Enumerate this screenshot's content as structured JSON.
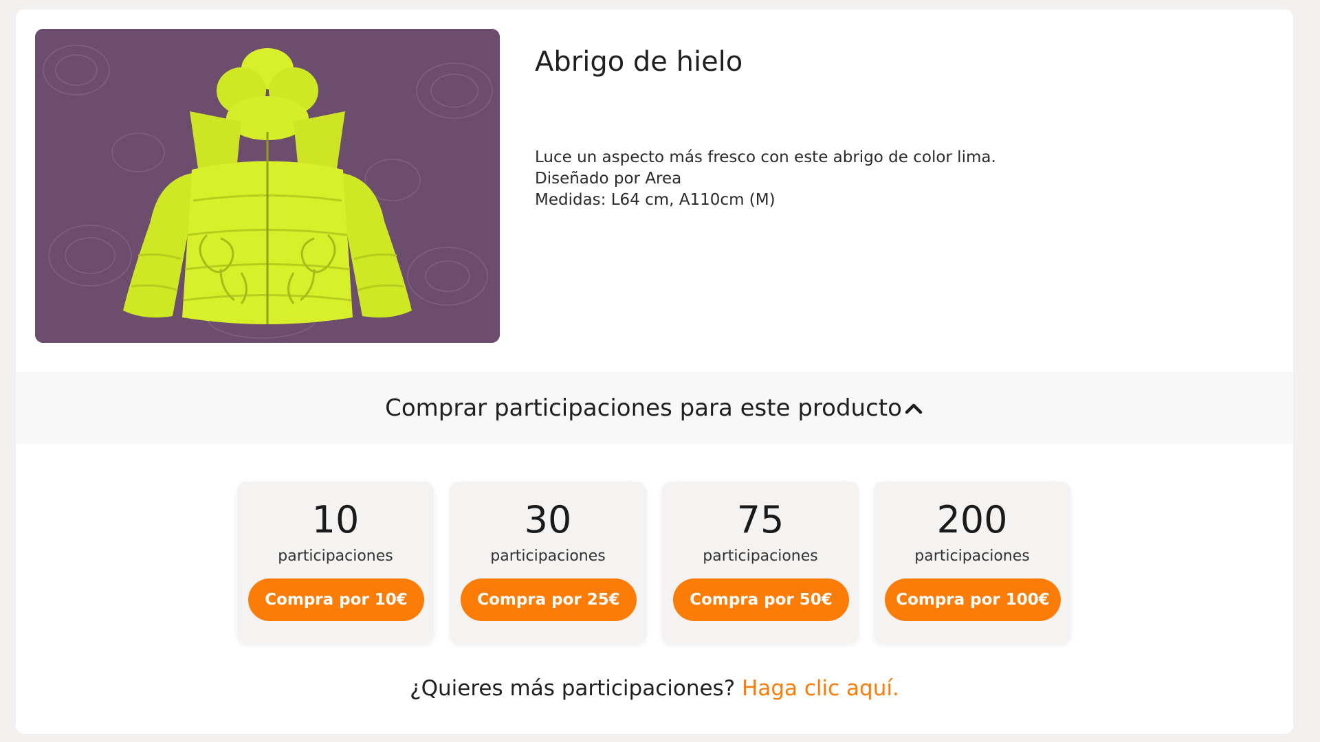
{
  "product": {
    "title": "Abrigo de hielo",
    "image_alt": "Abrigo puffer de color lima",
    "description": [
      "Luce un aspecto más fresco con este abrigo de color lima.",
      "Diseñado por Area",
      "Medidas: L64 cm, A110cm (M)"
    ]
  },
  "accordion": {
    "title": "Comprar participaciones para este producto",
    "icon": "chevron-up-icon",
    "expanded": true
  },
  "packages": [
    {
      "count": "10",
      "unit": "participaciones",
      "button_label": "Compra por 10€"
    },
    {
      "count": "30",
      "unit": "participaciones",
      "button_label": "Compra por 25€"
    },
    {
      "count": "75",
      "unit": "participaciones",
      "button_label": "Compra por 50€"
    },
    {
      "count": "200",
      "unit": "participaciones",
      "button_label": "Compra por 100€"
    }
  ],
  "more": {
    "question": "¿Quieres más participaciones?",
    "link_label": "Haga clic aquí."
  },
  "colors": {
    "accent": "#fb7c06",
    "image_background": "#6d4d6e",
    "jacket": "#d8f02a",
    "page_background": "#f2f1f0"
  }
}
